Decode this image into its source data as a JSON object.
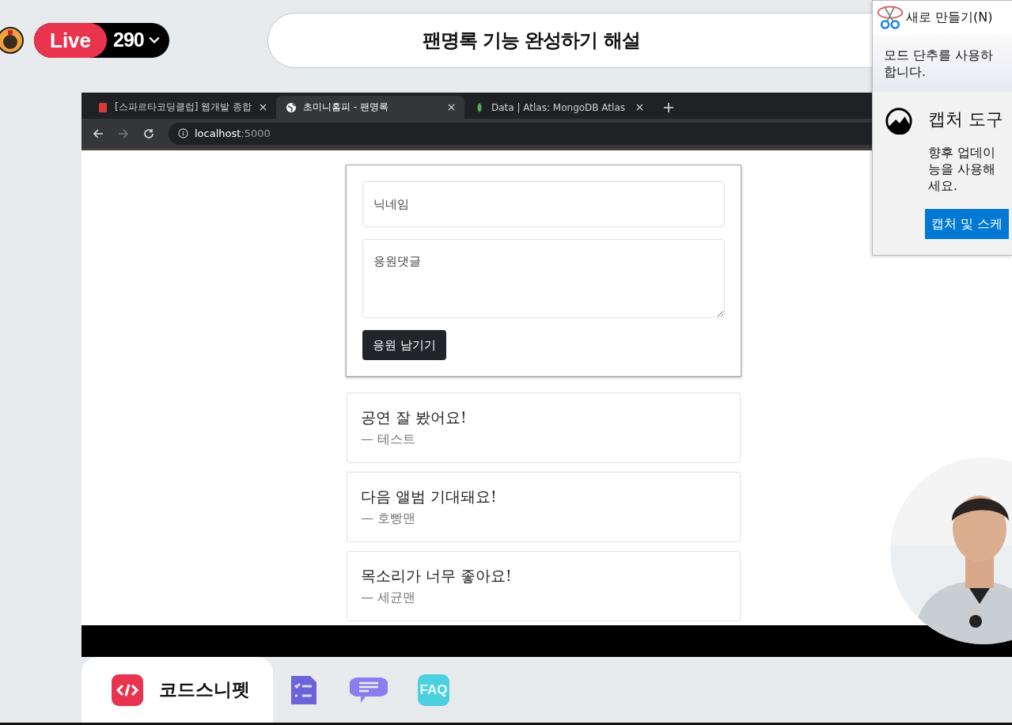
{
  "stream": {
    "live_label": "Live",
    "viewers": "290",
    "title": "팬명록 기능 완성하기 해설"
  },
  "browser": {
    "tabs": [
      {
        "kind": "book",
        "label": "[스파르타코딩클럽] 웹개발 종합",
        "selected": false
      },
      {
        "kind": "globe",
        "label": "초미니홈피 - 팬명록",
        "selected": true
      },
      {
        "kind": "leaf",
        "label": "Data | Atlas: MongoDB Atlas",
        "selected": false
      }
    ],
    "url_host": "localhost",
    "url_port": ":5000"
  },
  "form": {
    "nickname_placeholder": "닉네임",
    "comment_placeholder": "응원댓글",
    "submit": "응원 남기기"
  },
  "comments": [
    {
      "text": "공연 잘 봤어요!",
      "author": "— 테스트"
    },
    {
      "text": "다음 앨범 기대돼요!",
      "author": "— 호빵맨"
    },
    {
      "text": "목소리가 너무 좋아요!",
      "author": "— 세균맨"
    }
  ],
  "snip_popup": {
    "new_button": "새로 만들기(N)",
    "mode_note": [
      "모드 단추를 사용하",
      "합니다."
    ],
    "title": "캡처 도구",
    "body": [
      "향후 업데이",
      "능을 사용해",
      "세요."
    ],
    "action": "캡처 및 스케"
  },
  "bottom_nav": [
    {
      "kind": "code",
      "label": "코드스니펫",
      "selected": true
    },
    {
      "kind": "checklist",
      "selected": false
    },
    {
      "kind": "chat",
      "selected": false
    },
    {
      "kind": "faq",
      "label": "FAQ",
      "selected": false
    }
  ]
}
